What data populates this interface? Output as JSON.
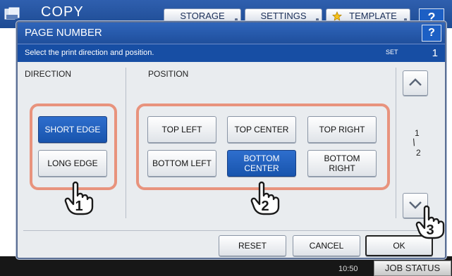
{
  "app": {
    "title": "COPY",
    "buttons": [
      {
        "label": "STORAGE"
      },
      {
        "label": "SETTINGS"
      },
      {
        "label": "TEMPLATE"
      }
    ],
    "help": "?",
    "clock": "10:50",
    "job_status": "JOB STATUS"
  },
  "dialog": {
    "title": "PAGE NUMBER",
    "help": "?",
    "instruction": "Select the print direction and position.",
    "set_label": "SET",
    "set_value": "1",
    "direction": {
      "label": "DIRECTION",
      "options": [
        {
          "label": "SHORT EDGE",
          "selected": true
        },
        {
          "label": "LONG EDGE",
          "selected": false
        }
      ]
    },
    "position": {
      "label": "POSITION",
      "options": [
        {
          "label": "TOP LEFT",
          "selected": false
        },
        {
          "label": "TOP CENTER",
          "selected": false
        },
        {
          "label": "TOP RIGHT",
          "selected": false
        },
        {
          "label": "BOTTOM LEFT",
          "selected": false
        },
        {
          "label": "BOTTOM\nCENTER",
          "selected": true
        },
        {
          "label": "BOTTOM\nRIGHT",
          "selected": false
        }
      ]
    },
    "pager": {
      "current": "1",
      "total": "2"
    },
    "footer": {
      "reset": "RESET",
      "cancel": "CANCEL",
      "ok": "OK"
    }
  },
  "callouts": [
    "1",
    "2",
    "3"
  ],
  "colors": {
    "title_bar": "#1f4f9c",
    "selected": "#1854ad",
    "highlight": "#e8937d"
  }
}
